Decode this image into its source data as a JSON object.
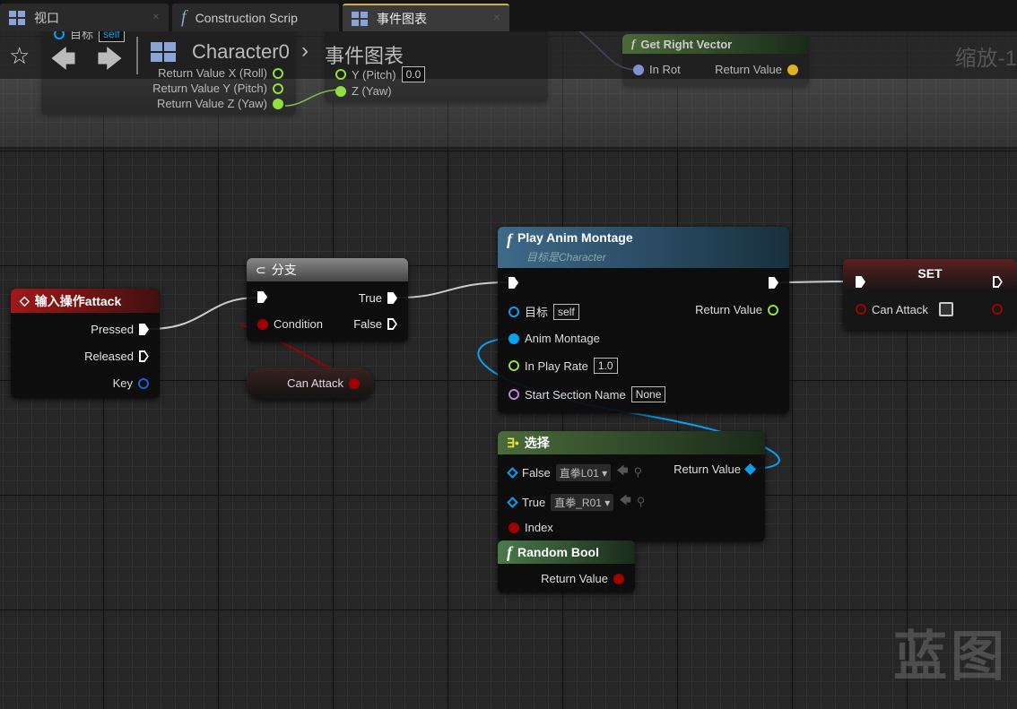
{
  "tabs": [
    {
      "label": "视口",
      "icon": "viewport-grid-icon"
    },
    {
      "label": "Construction Scrip",
      "icon": "function-icon"
    },
    {
      "label": "事件图表",
      "icon": "event-graph-icon",
      "active": true
    }
  ],
  "breadcrumb": {
    "root": "Character0",
    "current": "事件图表"
  },
  "zoom_label": "缩放-1",
  "watermark": "蓝图",
  "bg_nodes": {
    "break_rot": {
      "target_label": "目标",
      "target_value": "self",
      "out_x": "Return Value X (Roll)",
      "out_y": "Return Value Y (Pitch)",
      "out_z": "Return Value Z (Yaw)"
    },
    "make_rot": {
      "y_label": "Y (Pitch)",
      "y_value": "0.0",
      "z_label": "Z (Yaw)"
    },
    "get_right": {
      "title": "Get Right Vector",
      "in": "In Rot",
      "out": "Return Value"
    }
  },
  "input_node": {
    "title": "输入操作attack",
    "pins": [
      "Pressed",
      "Released",
      "Key"
    ]
  },
  "branch": {
    "title": "分支",
    "condition": "Condition",
    "true": "True",
    "false": "False"
  },
  "getter": {
    "label": "Can Attack"
  },
  "montage": {
    "title": "Play Anim Montage",
    "subtitle": "目标是Character",
    "target": "目标",
    "target_value": "self",
    "return": "Return Value",
    "anim": "Anim Montage",
    "rate": "In Play Rate",
    "rate_value": "1.0",
    "section": "Start Section Name",
    "section_value": "None"
  },
  "set": {
    "title": "SET",
    "var": "Can Attack",
    "checked": false
  },
  "select": {
    "title": "选择",
    "false": "False",
    "false_value": "直拳L01",
    "true": "True",
    "true_value": "直拳_R01",
    "index": "Index",
    "return": "Return Value"
  },
  "random": {
    "title": "Random Bool",
    "return": "Return Value"
  },
  "colors": {
    "exec": "#ffffff",
    "bool": "#a00000",
    "object": "#0aa0f0",
    "float": "#90e040",
    "name": "#c080e0",
    "rotator": "#8090d0",
    "vector": "#e0b020"
  }
}
